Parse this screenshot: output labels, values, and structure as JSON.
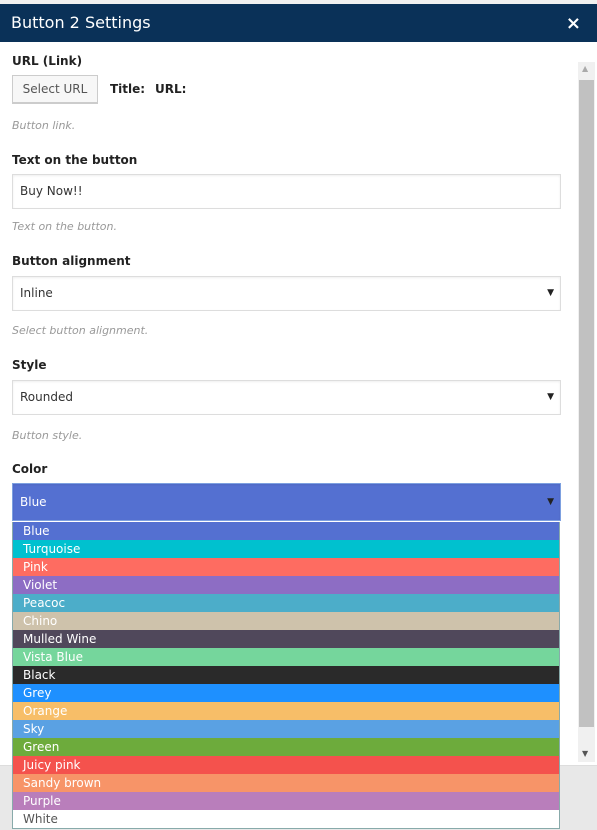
{
  "header": {
    "title": "Button 2 Settings",
    "close": "×"
  },
  "url": {
    "label": "URL (Link)",
    "button": "Select URL",
    "title_label": "Title:",
    "url_label": "URL:",
    "hint": "Button link."
  },
  "text": {
    "label": "Text on the button",
    "value": "Buy Now!!",
    "hint": "Text on the button."
  },
  "alignment": {
    "label": "Button alignment",
    "value": "Inline",
    "hint": "Select button alignment."
  },
  "style": {
    "label": "Style",
    "value": "Rounded",
    "hint": "Button style."
  },
  "color": {
    "label": "Color",
    "value": "Blue",
    "options": [
      {
        "label": "Blue",
        "color": "#5470d1"
      },
      {
        "label": "Turquoise",
        "color": "#00c1cf"
      },
      {
        "label": "Pink",
        "color": "#fe6c61"
      },
      {
        "label": "Violet",
        "color": "#8d6dc4"
      },
      {
        "label": "Peacoc",
        "color": "#4cadc9"
      },
      {
        "label": "Chino",
        "color": "#cec2ab"
      },
      {
        "label": "Mulled Wine",
        "color": "#50485b"
      },
      {
        "label": "Vista Blue",
        "color": "#75d69c"
      },
      {
        "label": "Black",
        "color": "#2a2a2a"
      },
      {
        "label": "Grey",
        "color": "#1e90ff"
      },
      {
        "label": "Orange",
        "color": "#f7be68"
      },
      {
        "label": "Sky",
        "color": "#5aa1e3"
      },
      {
        "label": "Green",
        "color": "#6dab3c"
      },
      {
        "label": "Juicy pink",
        "color": "#f4524d"
      },
      {
        "label": "Sandy brown",
        "color": "#f79468"
      },
      {
        "label": "Purple",
        "color": "#b97ebb"
      },
      {
        "label": "White",
        "color": "#ffffff"
      }
    ]
  }
}
